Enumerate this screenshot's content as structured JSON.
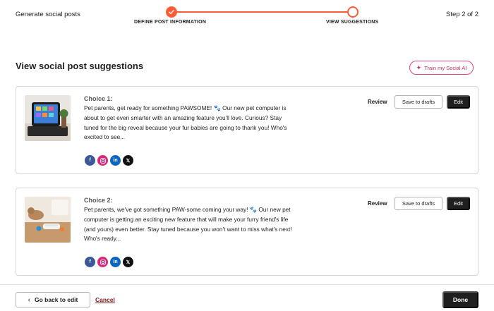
{
  "header": {
    "title": "Generate social posts",
    "step_count": "Step 2 of 2",
    "steps": [
      {
        "label": "DEFINE POST INFORMATION",
        "status": "complete"
      },
      {
        "label": "VIEW SUGGESTIONS",
        "status": "current"
      }
    ],
    "accent_color": "#ff5c35"
  },
  "main": {
    "title": "View social post suggestions",
    "train_button_label": "Train my Social AI",
    "cards": [
      {
        "choice_label": "Choice 1:",
        "text": "Pet parents, get ready for something PAWSOME! 🐾 Our new pet computer is about to get even smarter with an amazing feature you'll love. Curious? Stay tuned for the big reveal because your fur babies are going to thank you! Who's excited to see...",
        "review_label": "Review",
        "drafts_label": "Save to drafts",
        "edit_label": "Edit",
        "networks": [
          "facebook-icon",
          "instagram-icon",
          "linkedin-icon",
          "x-icon"
        ]
      },
      {
        "choice_label": "Choice 2:",
        "text": "Pet parents, we've got something PAW-some coming your way! 🐾 Our new pet computer is getting an exciting new feature that will make your furry friend's life (and yours) even better. Stay tuned because you won't want to miss what's next! Who's ready...",
        "review_label": "Review",
        "drafts_label": "Save to drafts",
        "edit_label": "Edit",
        "networks": [
          "facebook-icon",
          "instagram-icon",
          "linkedin-icon",
          "x-icon"
        ]
      }
    ]
  },
  "footer": {
    "back_label": "Go back to edit",
    "cancel_label": "Cancel",
    "done_label": "Done"
  }
}
